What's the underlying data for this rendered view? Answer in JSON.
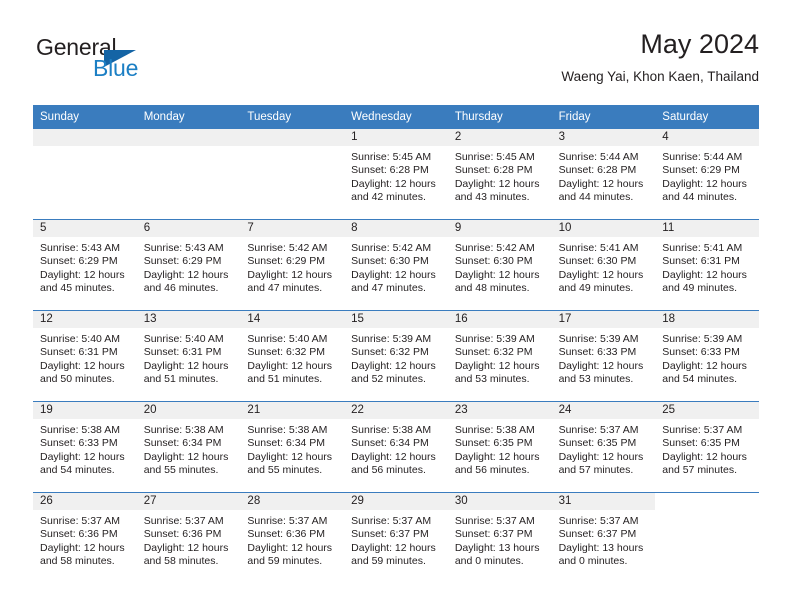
{
  "brand": {
    "name_top": "General",
    "name_bottom": "Blue",
    "triangle_color": "#1464a5",
    "blue_color": "#1c7fc4"
  },
  "header": {
    "title": "May 2024",
    "subtitle": "Waeng Yai, Khon Kaen, Thailand"
  },
  "theme": {
    "header_blue": "#3a7cbe",
    "day_strip_gray": "#f0f0f0",
    "text_color": "#231f20"
  },
  "weekdays": [
    "Sunday",
    "Monday",
    "Tuesday",
    "Wednesday",
    "Thursday",
    "Friday",
    "Saturday"
  ],
  "weeks": [
    [
      {
        "day": "",
        "lines": []
      },
      {
        "day": "",
        "lines": []
      },
      {
        "day": "",
        "lines": []
      },
      {
        "day": "1",
        "lines": [
          "Sunrise: 5:45 AM",
          "Sunset: 6:28 PM",
          "Daylight: 12 hours",
          "and 42 minutes."
        ]
      },
      {
        "day": "2",
        "lines": [
          "Sunrise: 5:45 AM",
          "Sunset: 6:28 PM",
          "Daylight: 12 hours",
          "and 43 minutes."
        ]
      },
      {
        "day": "3",
        "lines": [
          "Sunrise: 5:44 AM",
          "Sunset: 6:28 PM",
          "Daylight: 12 hours",
          "and 44 minutes."
        ]
      },
      {
        "day": "4",
        "lines": [
          "Sunrise: 5:44 AM",
          "Sunset: 6:29 PM",
          "Daylight: 12 hours",
          "and 44 minutes."
        ]
      }
    ],
    [
      {
        "day": "5",
        "lines": [
          "Sunrise: 5:43 AM",
          "Sunset: 6:29 PM",
          "Daylight: 12 hours",
          "and 45 minutes."
        ]
      },
      {
        "day": "6",
        "lines": [
          "Sunrise: 5:43 AM",
          "Sunset: 6:29 PM",
          "Daylight: 12 hours",
          "and 46 minutes."
        ]
      },
      {
        "day": "7",
        "lines": [
          "Sunrise: 5:42 AM",
          "Sunset: 6:29 PM",
          "Daylight: 12 hours",
          "and 47 minutes."
        ]
      },
      {
        "day": "8",
        "lines": [
          "Sunrise: 5:42 AM",
          "Sunset: 6:30 PM",
          "Daylight: 12 hours",
          "and 47 minutes."
        ]
      },
      {
        "day": "9",
        "lines": [
          "Sunrise: 5:42 AM",
          "Sunset: 6:30 PM",
          "Daylight: 12 hours",
          "and 48 minutes."
        ]
      },
      {
        "day": "10",
        "lines": [
          "Sunrise: 5:41 AM",
          "Sunset: 6:30 PM",
          "Daylight: 12 hours",
          "and 49 minutes."
        ]
      },
      {
        "day": "11",
        "lines": [
          "Sunrise: 5:41 AM",
          "Sunset: 6:31 PM",
          "Daylight: 12 hours",
          "and 49 minutes."
        ]
      }
    ],
    [
      {
        "day": "12",
        "lines": [
          "Sunrise: 5:40 AM",
          "Sunset: 6:31 PM",
          "Daylight: 12 hours",
          "and 50 minutes."
        ]
      },
      {
        "day": "13",
        "lines": [
          "Sunrise: 5:40 AM",
          "Sunset: 6:31 PM",
          "Daylight: 12 hours",
          "and 51 minutes."
        ]
      },
      {
        "day": "14",
        "lines": [
          "Sunrise: 5:40 AM",
          "Sunset: 6:32 PM",
          "Daylight: 12 hours",
          "and 51 minutes."
        ]
      },
      {
        "day": "15",
        "lines": [
          "Sunrise: 5:39 AM",
          "Sunset: 6:32 PM",
          "Daylight: 12 hours",
          "and 52 minutes."
        ]
      },
      {
        "day": "16",
        "lines": [
          "Sunrise: 5:39 AM",
          "Sunset: 6:32 PM",
          "Daylight: 12 hours",
          "and 53 minutes."
        ]
      },
      {
        "day": "17",
        "lines": [
          "Sunrise: 5:39 AM",
          "Sunset: 6:33 PM",
          "Daylight: 12 hours",
          "and 53 minutes."
        ]
      },
      {
        "day": "18",
        "lines": [
          "Sunrise: 5:39 AM",
          "Sunset: 6:33 PM",
          "Daylight: 12 hours",
          "and 54 minutes."
        ]
      }
    ],
    [
      {
        "day": "19",
        "lines": [
          "Sunrise: 5:38 AM",
          "Sunset: 6:33 PM",
          "Daylight: 12 hours",
          "and 54 minutes."
        ]
      },
      {
        "day": "20",
        "lines": [
          "Sunrise: 5:38 AM",
          "Sunset: 6:34 PM",
          "Daylight: 12 hours",
          "and 55 minutes."
        ]
      },
      {
        "day": "21",
        "lines": [
          "Sunrise: 5:38 AM",
          "Sunset: 6:34 PM",
          "Daylight: 12 hours",
          "and 55 minutes."
        ]
      },
      {
        "day": "22",
        "lines": [
          "Sunrise: 5:38 AM",
          "Sunset: 6:34 PM",
          "Daylight: 12 hours",
          "and 56 minutes."
        ]
      },
      {
        "day": "23",
        "lines": [
          "Sunrise: 5:38 AM",
          "Sunset: 6:35 PM",
          "Daylight: 12 hours",
          "and 56 minutes."
        ]
      },
      {
        "day": "24",
        "lines": [
          "Sunrise: 5:37 AM",
          "Sunset: 6:35 PM",
          "Daylight: 12 hours",
          "and 57 minutes."
        ]
      },
      {
        "day": "25",
        "lines": [
          "Sunrise: 5:37 AM",
          "Sunset: 6:35 PM",
          "Daylight: 12 hours",
          "and 57 minutes."
        ]
      }
    ],
    [
      {
        "day": "26",
        "lines": [
          "Sunrise: 5:37 AM",
          "Sunset: 6:36 PM",
          "Daylight: 12 hours",
          "and 58 minutes."
        ]
      },
      {
        "day": "27",
        "lines": [
          "Sunrise: 5:37 AM",
          "Sunset: 6:36 PM",
          "Daylight: 12 hours",
          "and 58 minutes."
        ]
      },
      {
        "day": "28",
        "lines": [
          "Sunrise: 5:37 AM",
          "Sunset: 6:36 PM",
          "Daylight: 12 hours",
          "and 59 minutes."
        ]
      },
      {
        "day": "29",
        "lines": [
          "Sunrise: 5:37 AM",
          "Sunset: 6:37 PM",
          "Daylight: 12 hours",
          "and 59 minutes."
        ]
      },
      {
        "day": "30",
        "lines": [
          "Sunrise: 5:37 AM",
          "Sunset: 6:37 PM",
          "Daylight: 13 hours",
          "and 0 minutes."
        ]
      },
      {
        "day": "31",
        "lines": [
          "Sunrise: 5:37 AM",
          "Sunset: 6:37 PM",
          "Daylight: 13 hours",
          "and 0 minutes."
        ]
      }
    ]
  ]
}
